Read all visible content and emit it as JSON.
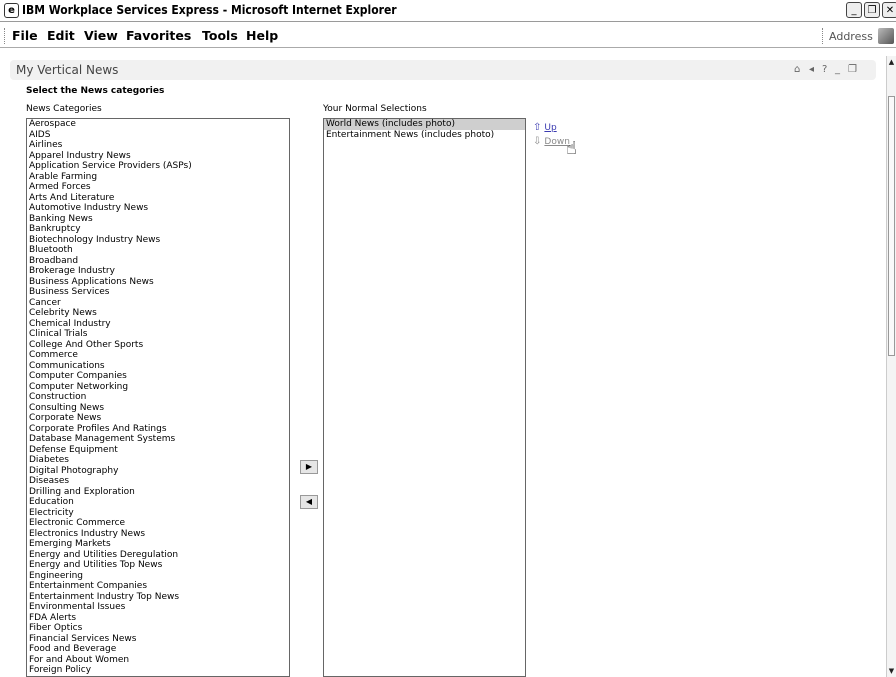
{
  "window": {
    "title": "IBM Workplace Services Express - Microsoft Internet Explorer",
    "icon": "ie-icon",
    "controls": [
      "_",
      "❐",
      "✕"
    ]
  },
  "menubar": {
    "items": [
      "File",
      "Edit",
      "View",
      "Favorites",
      "Tools",
      "Help"
    ],
    "address_label": "Address"
  },
  "portlet": {
    "title": "My Vertical News",
    "controls": [
      "⌂",
      "◂",
      "?",
      "_",
      "❐"
    ]
  },
  "form": {
    "heading": "Select the News categories",
    "categories_label": "News Categories",
    "selections_label": "Your Normal Selections",
    "categories": [
      "Aerospace",
      "AIDS",
      "Airlines",
      "Apparel Industry News",
      "Application Service Providers (ASPs)",
      "Arable Farming",
      "Armed Forces",
      "Arts And Literature",
      "Automotive Industry News",
      "Banking News",
      "Bankruptcy",
      "Biotechnology Industry News",
      "Bluetooth",
      "Broadband",
      "Brokerage Industry",
      "Business Applications News",
      "Business Services",
      "Cancer",
      "Celebrity News",
      "Chemical Industry",
      "Clinical Trials",
      "College And Other Sports",
      "Commerce",
      "Communications",
      "Computer Companies",
      "Computer Networking",
      "Construction",
      "Consulting News",
      "Corporate News",
      "Corporate Profiles And Ratings",
      "Database Management Systems",
      "Defense Equipment",
      "Diabetes",
      "Digital Photography",
      "Diseases",
      "Drilling and Exploration",
      "Education",
      "Electricity",
      "Electronic Commerce",
      "Electronics Industry News",
      "Emerging Markets",
      "Energy and Utilities Deregulation",
      "Energy and Utilities Top News",
      "Engineering",
      "Entertainment Companies",
      "Entertainment Industry Top News",
      "Environmental Issues",
      "FDA Alerts",
      "Fiber Optics",
      "Financial Services News",
      "Food and Beverage",
      "For and About Women",
      "Foreign Policy"
    ],
    "selections": [
      {
        "label": "World News (includes photo)",
        "selected": true
      },
      {
        "label": "Entertainment News (includes photo)",
        "selected": false
      }
    ],
    "add_symbol": "▶",
    "remove_symbol": "◀",
    "up_arrow": "⇧",
    "up_label": "Up",
    "down_arrow": "⇩",
    "down_label": "Down"
  },
  "colors": {
    "link": "#3a3ab0",
    "link_disabled": "#8a8a8a",
    "selection_bg": "#cfcfcf"
  }
}
